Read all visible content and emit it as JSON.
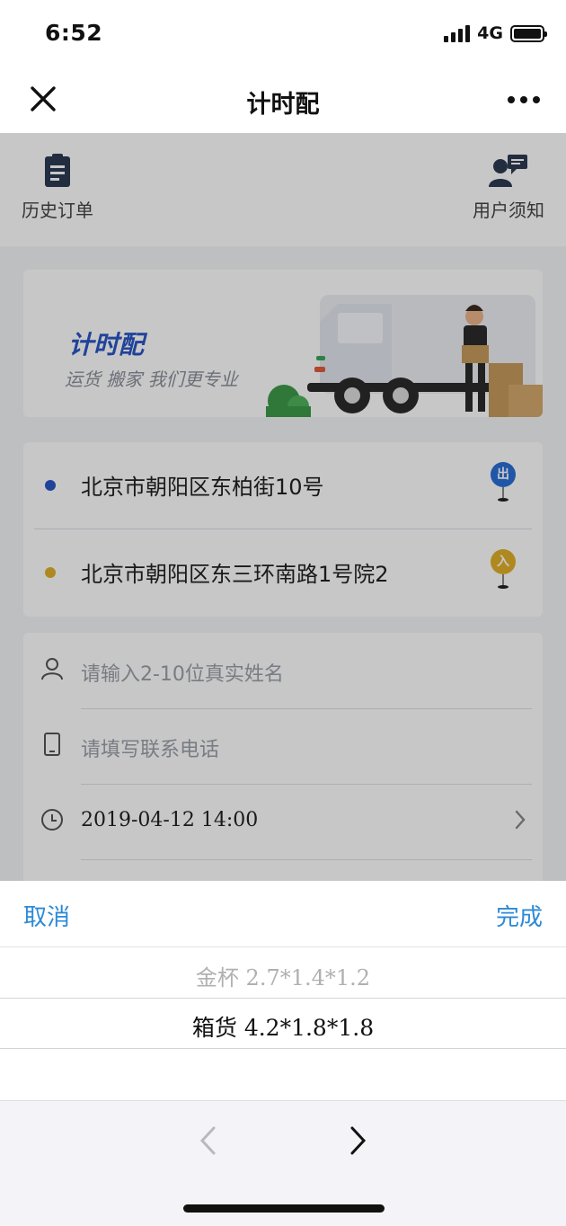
{
  "status_bar": {
    "time": "6:52",
    "network": "4G"
  },
  "nav": {
    "title": "计时配"
  },
  "top_actions": {
    "history": "历史订单",
    "notice": "用户须知"
  },
  "banner": {
    "title": "计时配",
    "subtitle": "运货 搬家 我们更专业"
  },
  "addresses": [
    {
      "text": "北京市朝阳区东柏街10号",
      "dot_color": "#2a56c6",
      "pin_label": "出",
      "pin_color": "#2a6fd6"
    },
    {
      "text": "北京市朝阳区东三环南路1号院2",
      "dot_color": "#e0b02a",
      "pin_label": "入",
      "pin_color": "#e0b02a"
    }
  ],
  "form": {
    "name_placeholder": "请输入2-10位真实姓名",
    "phone_placeholder": "请填写联系电话",
    "time_value": "2019-04-12 14:00"
  },
  "picker": {
    "cancel": "取消",
    "done": "完成",
    "options": [
      "金杯 2.7*1.4*1.2",
      "箱货 4.2*1.8*1.8"
    ],
    "selected_index": 1
  },
  "colors": {
    "accent": "#2d8ad7",
    "brand_blue": "#2a56c6"
  }
}
